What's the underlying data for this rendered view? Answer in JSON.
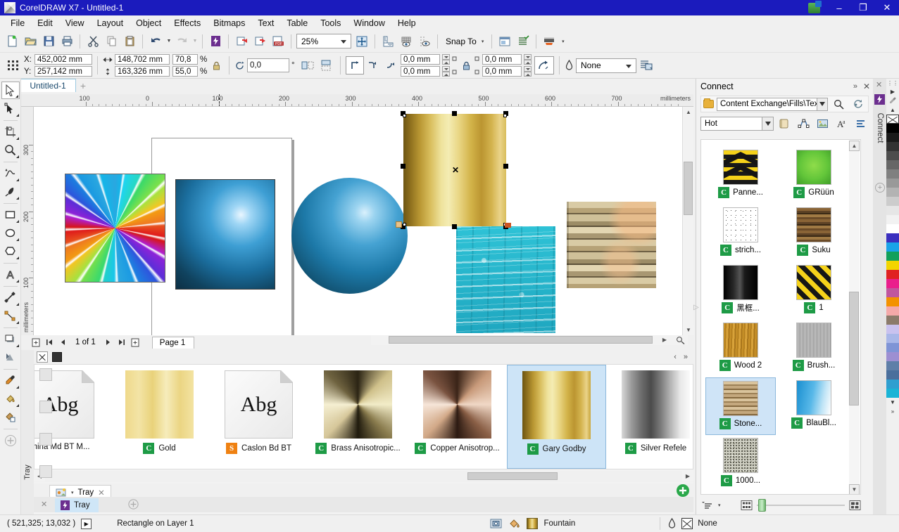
{
  "window": {
    "title": "CorelDRAW X7 - Untitled-1",
    "logo_icon": "coreldraw-logo-icon",
    "minimize_label": "–",
    "restore_label": "❐",
    "close_label": "✕",
    "titlebar_color": "#1b1bbd"
  },
  "menubar": {
    "items": [
      {
        "label": "File",
        "mnemonic": "F"
      },
      {
        "label": "Edit",
        "mnemonic": "E"
      },
      {
        "label": "View",
        "mnemonic": "V"
      },
      {
        "label": "Layout",
        "mnemonic": "L"
      },
      {
        "label": "Object",
        "mnemonic": "O"
      },
      {
        "label": "Effects",
        "mnemonic": "c"
      },
      {
        "label": "Bitmaps",
        "mnemonic": "B"
      },
      {
        "label": "Text",
        "mnemonic": "x"
      },
      {
        "label": "Table",
        "mnemonic": "T"
      },
      {
        "label": "Tools",
        "mnemonic": "o"
      },
      {
        "label": "Window",
        "mnemonic": "W"
      },
      {
        "label": "Help",
        "mnemonic": "H"
      }
    ]
  },
  "toolbar": {
    "buttons": [
      "new-document-icon",
      "open-document-icon",
      "save-icon",
      "print-icon",
      "cut-icon",
      "copy-icon",
      "paste-icon",
      "undo-icon",
      "undo-dropdown-icon",
      "redo-icon",
      "redo-dropdown-icon",
      "import-icon",
      "export-icon",
      "publish-to-pdf-icon",
      "corel-connect-icon"
    ],
    "zoom_level": "25%",
    "zoom_dropdown_icon": "chevron-down-icon",
    "full_screen_icon": "zoom-levels-icon",
    "show_rulers_icon": "rulers-icon",
    "show_grid_icon": "grid-icon",
    "show_guidelines_icon": "guidelines-icon",
    "snap_to_label": "Snap To",
    "snap_to_caret": "▾",
    "options_icon": "options-icon",
    "document_properties_icon": "document-properties-icon",
    "launch_icon": "application-launcher-icon",
    "launch_caret": "▾"
  },
  "propertybar": {
    "object_position_icon": "object-position-icon",
    "x_label": "X:",
    "x_value": "452,002 mm",
    "y_label": "Y:",
    "y_value": "257,142 mm",
    "width_icon": "object-width-icon",
    "width_value": "148,702 mm",
    "height_icon": "object-height-icon",
    "height_value": "163,326 mm",
    "scale_w_value": "70,8",
    "scale_h_value": "55,0",
    "percent_symbol": "%",
    "lock_ratio_icon": "lock-ratio-icon",
    "rotate_icon": "rotation-angle-icon",
    "rotation_value": "0,0",
    "degree_symbol": "°",
    "mirror_h_icon": "mirror-horizontal-icon",
    "mirror_v_icon": "mirror-vertical-icon",
    "corner_square_icon": "square-corner-icon",
    "corner_scallop_icon": "scalloped-corner-icon",
    "corner_round_icon": "rounded-corner-icon",
    "corner_tl_value": "0,0 mm",
    "corner_bl_value": "0,0 mm",
    "corner_tr_value": "0,0 mm",
    "corner_br_value": "0,0 mm",
    "corner_lock_icon": "edit-corners-together-icon",
    "relative_corner_icon": "relative-corner-scaling-icon",
    "outline_width_icon": "outline-width-icon",
    "outline_width_value": "None",
    "outline_dropdown_icon": "chevron-down-icon",
    "wrap_text_icon": "wrap-paragraph-text-icon"
  },
  "document_tab": {
    "label": "Untitled-1",
    "add_label": "+"
  },
  "toolbox": {
    "tools": [
      {
        "name": "pick-tool",
        "selected": true,
        "flyout": true
      },
      {
        "name": "shape-tool",
        "selected": false,
        "flyout": true
      },
      {
        "name": "crop-tool",
        "selected": false,
        "flyout": true
      },
      {
        "name": "zoom-tool",
        "selected": false,
        "flyout": true
      },
      {
        "name": "freehand-tool",
        "selected": false,
        "flyout": true
      },
      {
        "name": "artistic-media-tool",
        "selected": false,
        "flyout": true
      },
      {
        "name": "rectangle-tool",
        "selected": false,
        "flyout": true
      },
      {
        "name": "ellipse-tool",
        "selected": false,
        "flyout": true
      },
      {
        "name": "polygon-tool",
        "selected": false,
        "flyout": true
      },
      {
        "name": "text-tool",
        "selected": false,
        "flyout": true
      },
      {
        "name": "parallel-dimension-tool",
        "selected": false,
        "flyout": true
      },
      {
        "name": "straight-line-connector-tool",
        "selected": false,
        "flyout": true
      },
      {
        "name": "drop-shadow-tool",
        "selected": false,
        "flyout": true
      },
      {
        "name": "transparency-tool",
        "selected": false,
        "flyout": false
      },
      {
        "name": "color-eyedropper-tool",
        "selected": false,
        "flyout": true
      },
      {
        "name": "interactive-fill-tool",
        "selected": false,
        "flyout": true
      },
      {
        "name": "smart-fill-tool",
        "selected": false,
        "flyout": false
      },
      {
        "name": "add-tool-button",
        "selected": false,
        "flyout": false
      }
    ]
  },
  "ruler": {
    "unit_label": "millimeters",
    "h_ticks": [
      "100",
      "0",
      "100",
      "200",
      "300",
      "400",
      "500",
      "600",
      "700"
    ],
    "v_ticks": [
      "300",
      "200",
      "100"
    ],
    "v_unit_label": "millimeters"
  },
  "canvas": {
    "objects": [
      {
        "name": "conical-rainbow-rectangle",
        "fill": "conical fountain fill"
      },
      {
        "name": "radial-blue-rectangle",
        "fill": "radial fountain fill"
      },
      {
        "name": "blue-sphere",
        "fill": "radial fountain fill"
      },
      {
        "name": "gold-rectangle-selected",
        "fill": "Gary Godby linear fountain fill"
      },
      {
        "name": "water-texture-rectangle",
        "fill": "bitmap pattern fill"
      },
      {
        "name": "brick-texture-rectangle",
        "fill": "bitmap pattern fill"
      }
    ],
    "selection_center_marker": "✕"
  },
  "page_navigator": {
    "add_page_start_icon": "add-page-icon",
    "first_page_icon": "first-page-icon",
    "prev_page_icon": "previous-page-icon",
    "page_counter": "1 of 1",
    "next_page_icon": "next-page-icon",
    "last_page_icon": "last-page-icon",
    "add_page_end_icon": "add-page-icon",
    "page_tab_label": "Page 1"
  },
  "tray": {
    "side_label": "Tray",
    "toolbar_icons": [
      "close-tray-icon",
      "tray-thumbnail-icon",
      "tray-dropdown-icon"
    ],
    "tab_label": "Tray",
    "tab_close_icon": "close-icon",
    "dock_tab_label": "Tray",
    "dock_tab_icon": "corel-connect-icon",
    "dock_close_icon": "close-icon",
    "add_tray_icon": "add-tray-icon",
    "scroll_left_icon": "scroll-left-icon",
    "scroll_right_icon": "scroll-right-icon",
    "add_item_icon": "add-item-icon",
    "items": [
      {
        "label": "mina Md BT M...",
        "badge": "",
        "badge_type": "none",
        "thumb": "document-thumb",
        "glyph": "Abg",
        "selected": false
      },
      {
        "label": "Gold",
        "badge": "C",
        "badge_type": "c",
        "thumb": "gold-soft-fill",
        "glyph": "",
        "selected": false
      },
      {
        "label": "Caslon Bd BT",
        "badge": "S",
        "badge_type": "s",
        "thumb": "document-thumb",
        "glyph": "Abg",
        "selected": false
      },
      {
        "label": "Brass Anisotropic...",
        "badge": "C",
        "badge_type": "c",
        "thumb": "brass-anisotropic",
        "glyph": "",
        "selected": false
      },
      {
        "label": "Copper Anisotrop...",
        "badge": "C",
        "badge_type": "c",
        "thumb": "copper-anisotropic",
        "glyph": "",
        "selected": false
      },
      {
        "label": "Gary Godby",
        "badge": "C",
        "badge_type": "c",
        "thumb": "gary-godby-gold",
        "glyph": "",
        "selected": true
      },
      {
        "label": "Silver Refele",
        "badge": "C",
        "badge_type": "c",
        "thumb": "silver-reflection",
        "glyph": "",
        "selected": false
      }
    ]
  },
  "connect_docker": {
    "title": "Connect",
    "collapse_icon": "collapse-docker-icon",
    "close_icon": "close-icon",
    "path_folder_icon": "folder-icon",
    "path_value": "Content Exchange\\Fills\\Textur",
    "path_dropdown_icon": "chevron-down-icon",
    "search_icon": "search-icon",
    "sync_icon": "refresh-icon",
    "filter_value": "Hot",
    "filter_dropdown_icon": "chevron-down-icon",
    "filter_buttons": [
      "filter-fills-icon",
      "filter-vector-icon",
      "filter-bitmap-icon",
      "filter-fonts-icon",
      "filter-list-icon"
    ],
    "scroll_up_icon": "scroll-up-icon",
    "scroll_down_icon": "scroll-down-icon",
    "expand_left_icon": "expand-panel-icon",
    "items": [
      {
        "label": "Panne...",
        "badge": "C",
        "thumb": "chevron-hazard-yellow",
        "selected": false
      },
      {
        "label": "GRüün",
        "badge": "C",
        "thumb": "green-square",
        "selected": false
      },
      {
        "label": "strich...",
        "badge": "C",
        "thumb": "white-speckle",
        "selected": false
      },
      {
        "label": "Suku",
        "badge": "C",
        "thumb": "dark-wood-planks",
        "selected": false
      },
      {
        "label": "黑框...",
        "badge": "C",
        "thumb": "black-gradient",
        "selected": false
      },
      {
        "label": "1",
        "badge": "C",
        "thumb": "diagonal-hazard-yellow",
        "selected": false
      },
      {
        "label": "Wood 2",
        "badge": "C",
        "thumb": "golden-wood",
        "selected": false
      },
      {
        "label": "Brush...",
        "badge": "C",
        "thumb": "brushed-metal-grey",
        "selected": false
      },
      {
        "label": "Stone...",
        "badge": "C",
        "thumb": "stone-wall",
        "selected": true
      },
      {
        "label": "BlauBl...",
        "badge": "C",
        "thumb": "blue-white-gradient",
        "selected": false
      },
      {
        "label": "1000...",
        "badge": "C",
        "thumb": "grey-noise",
        "selected": false
      }
    ],
    "footer": {
      "sort_icon": "sort-icon",
      "sort_caret": "▾",
      "small_thumbs_icon": "small-thumbnails-icon",
      "large_thumbs_icon": "large-thumbnails-icon",
      "slider_value": "small"
    },
    "vertical_tab_label": "Connect",
    "vertical_tab_icon": "corel-connect-icon",
    "add_docker_icon": "add-docker-icon"
  },
  "palette": {
    "scroll_up_icon": "palette-scroll-up-icon",
    "scroll_down_icon": "palette-scroll-down-icon",
    "expand_icon": "palette-expand-icon",
    "nofill_icon": "no-fill-swatch",
    "colors": [
      "#000000",
      "#1a1a1a",
      "#333333",
      "#4d4d4d",
      "#666666",
      "#808080",
      "#999999",
      "#b3b3b3",
      "#cccccc",
      "#e6e6e6",
      "#f2f2f2",
      "#ffffff",
      "#3b2fbe",
      "#1aa3e8",
      "#13a05a",
      "#f2d500",
      "#e02121",
      "#ea1e8c",
      "#c0569e",
      "#f39200",
      "#f4a9a9",
      "#8b7b6b",
      "#c9c2ef",
      "#a9b7e8",
      "#7f94d6",
      "#9d8fd2",
      "#5f7fa8",
      "#4a6f9c",
      "#2f9fd0",
      "#1ab4d6"
    ]
  },
  "statusbar": {
    "coordinates": "( 521,325; 13,032 )",
    "play_icon": "expand-status-icon",
    "object_info": "Rectangle on Layer 1",
    "fill_monitor_icon": "color-proof-icon",
    "fill_bucket_icon": "fill-icon",
    "fill_label": "Fountain",
    "outline_pen_icon": "outline-pen-icon",
    "outline_label": "None"
  }
}
